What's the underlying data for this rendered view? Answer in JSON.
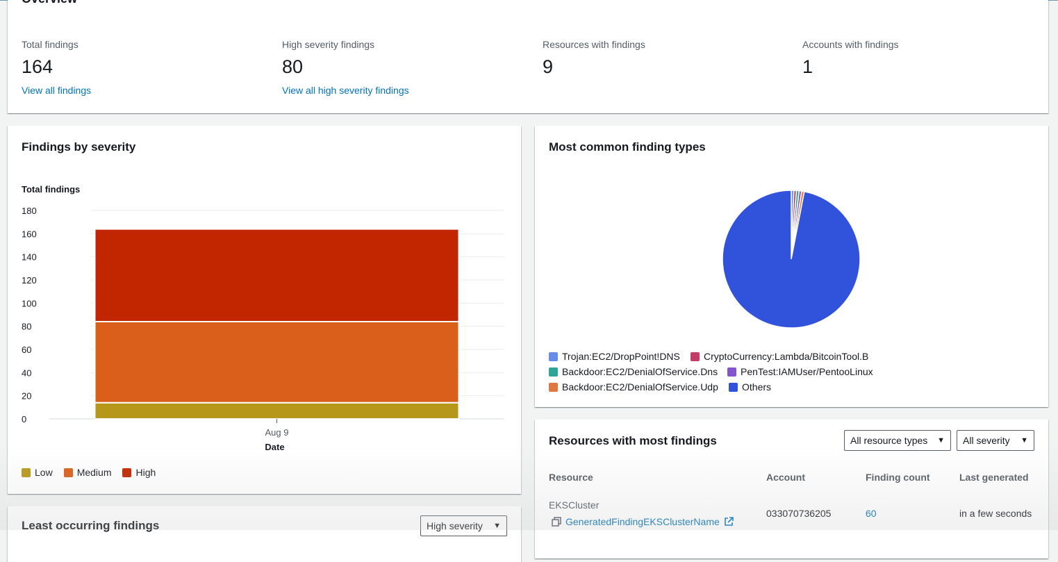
{
  "overview": {
    "title": "Overview",
    "stats": [
      {
        "label": "Total findings",
        "value": "164",
        "link": "View all findings"
      },
      {
        "label": "High severity findings",
        "value": "80",
        "link": "View all high severity findings"
      },
      {
        "label": "Resources with findings",
        "value": "9",
        "link": ""
      },
      {
        "label": "Accounts with findings",
        "value": "1",
        "link": ""
      }
    ]
  },
  "severity_card": {
    "title": "Findings by severity",
    "legend": [
      {
        "label": "Low",
        "color": "#b7971a"
      },
      {
        "label": "Medium",
        "color": "#d95f1b"
      },
      {
        "label": "High",
        "color": "#c12600"
      }
    ]
  },
  "chart_data": {
    "type": "bar",
    "stacked": true,
    "categories": [
      "Aug 9"
    ],
    "series": [
      {
        "name": "Low",
        "values": [
          14
        ],
        "color": "#b7971a"
      },
      {
        "name": "Medium",
        "values": [
          70
        ],
        "color": "#d95f1b"
      },
      {
        "name": "High",
        "values": [
          80
        ],
        "color": "#c12600"
      }
    ],
    "xlabel": "Date",
    "ylabel": "Total findings",
    "ylim": [
      0,
      180
    ],
    "yticks": [
      0,
      20,
      40,
      60,
      80,
      100,
      120,
      140,
      160,
      180
    ],
    "grid": true,
    "legend": "bottom-left"
  },
  "types_card": {
    "title": "Most common finding types",
    "pie": [
      {
        "label": "Trojan:EC2/DropPoint!DNS",
        "value": 1,
        "color": "#688ae8"
      },
      {
        "label": "CryptoCurrency:Lambda/BitcoinTool.B",
        "value": 1,
        "color": "#c33d69"
      },
      {
        "label": "Backdoor:EC2/DenialOfService.Dns",
        "value": 1,
        "color": "#2ea597"
      },
      {
        "label": "PenTest:IAMUser/PentooLinux",
        "value": 1,
        "color": "#8456ce"
      },
      {
        "label": "Backdoor:EC2/DenialOfService.Udp",
        "value": 1,
        "color": "#e07941"
      },
      {
        "label": "Others",
        "value": 159,
        "color": "#3153dc"
      }
    ]
  },
  "resources_card": {
    "title": "Resources with most findings",
    "filter_type": "All resource types",
    "filter_severity": "All severity",
    "columns": [
      "Resource",
      "Account",
      "Finding count",
      "Last generated"
    ],
    "rows": [
      {
        "resource_type": "EKSCluster",
        "resource_name": "GeneratedFindingEKSClusterName",
        "account": "033070736205",
        "count": "60",
        "last": "in a few seconds"
      }
    ]
  },
  "least_card": {
    "title": "Least occurring findings",
    "filter": "High severity"
  }
}
